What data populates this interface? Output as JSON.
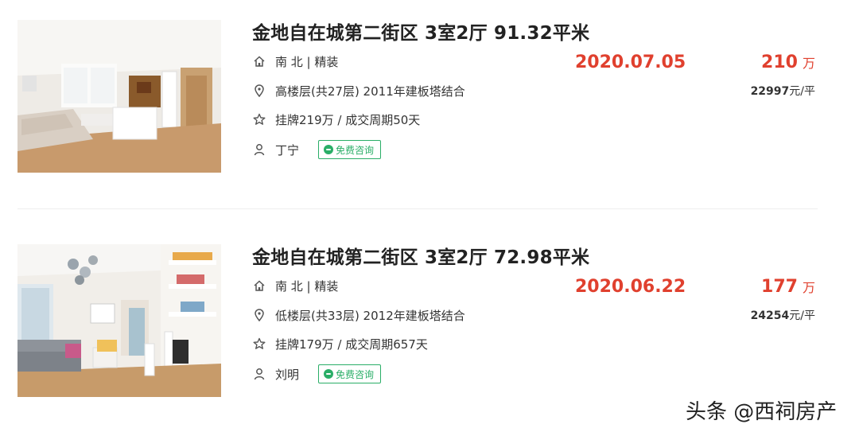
{
  "listings": [
    {
      "title": "金地自在城第二街区 3室2厅 91.32平米",
      "orientation_decor": "南 北 | 精装",
      "floor_info": "高楼层(共27层) 2011年建板塔结合",
      "listing_info": "挂牌219万 / 成交周期50天",
      "agent": "丁宁",
      "consult_label": "免费咨询",
      "deal_date": "2020.07.05",
      "total_price": "210",
      "price_unit": "万",
      "unit_price": "22997",
      "unit_price_suffix": "元/平"
    },
    {
      "title": "金地自在城第二街区 3室2厅 72.98平米",
      "orientation_decor": "南 北 | 精装",
      "floor_info": "低楼层(共33层) 2012年建板塔结合",
      "listing_info": "挂牌179万 / 成交周期657天",
      "agent": "刘明",
      "consult_label": "免费咨询",
      "deal_date": "2020.06.22",
      "total_price": "177",
      "price_unit": "万",
      "unit_price": "24254",
      "unit_price_suffix": "元/平"
    }
  ],
  "watermark": "头条 @西祠房产",
  "icons": {
    "house": "house-icon",
    "location": "location-pin-icon",
    "star": "star-icon",
    "person": "person-icon",
    "chat": "chat-bubble-icon"
  },
  "colors": {
    "price_red": "#e0402e",
    "consult_green": "#2aae67"
  }
}
